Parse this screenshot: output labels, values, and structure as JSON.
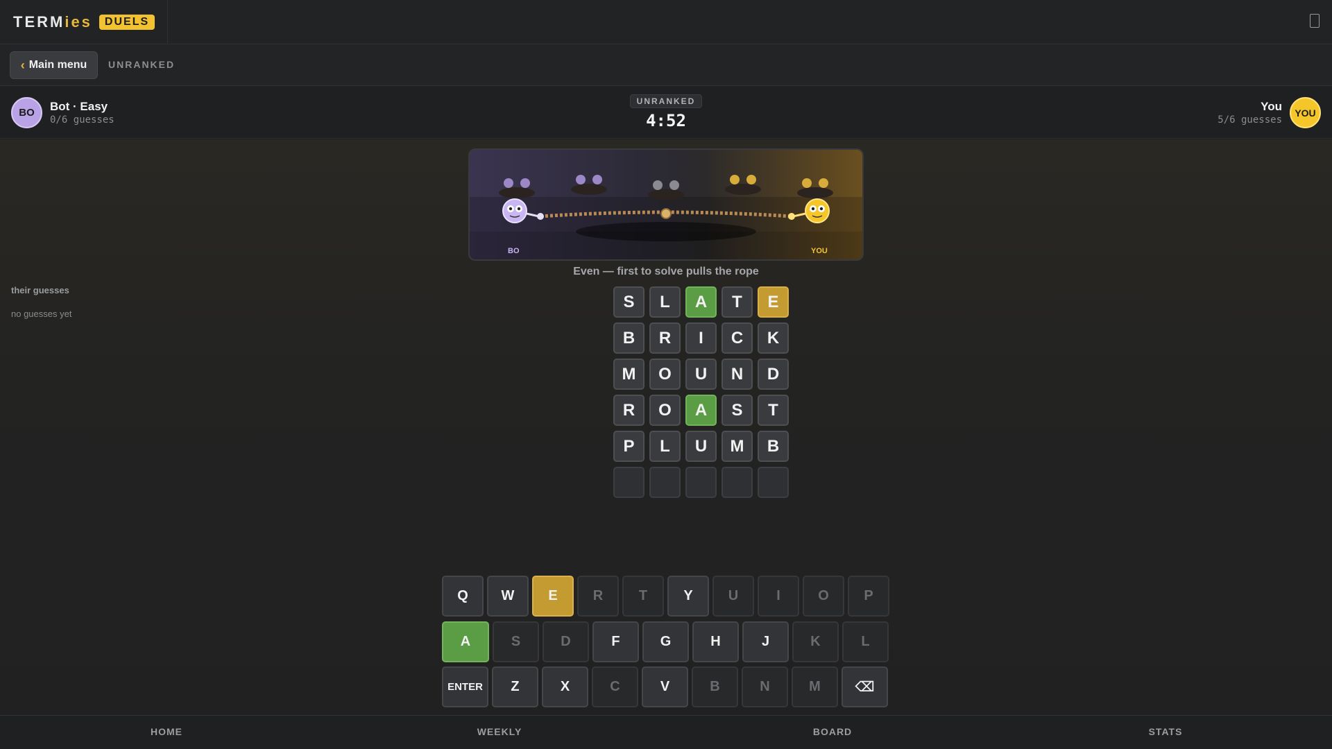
{
  "header": {
    "brand_main": "TERM",
    "brand_accent": "ies",
    "badge": "DUELS"
  },
  "subbar": {
    "back_label": "Main menu",
    "mode": "UNRANKED"
  },
  "match": {
    "opponent": {
      "initials": "BO",
      "name": "Bot · Easy",
      "guesses": "0/6 guesses"
    },
    "player": {
      "initials": "YOU",
      "name": "You",
      "guesses": "5/6 guesses"
    },
    "mode_badge": "UNRANKED",
    "timer": "4:52"
  },
  "side_panel": {
    "title": "their guesses",
    "empty_text": "no guesses yet"
  },
  "scene": {
    "left_label": "BO",
    "right_label": "YOU"
  },
  "status": "Even — first to solve pulls the rope",
  "board": {
    "rows": [
      [
        {
          "l": "S",
          "s": "absent"
        },
        {
          "l": "L",
          "s": "absent"
        },
        {
          "l": "A",
          "s": "correct"
        },
        {
          "l": "T",
          "s": "absent"
        },
        {
          "l": "E",
          "s": "present"
        }
      ],
      [
        {
          "l": "B",
          "s": "absent"
        },
        {
          "l": "R",
          "s": "absent"
        },
        {
          "l": "I",
          "s": "absent"
        },
        {
          "l": "C",
          "s": "absent"
        },
        {
          "l": "K",
          "s": "absent"
        }
      ],
      [
        {
          "l": "M",
          "s": "absent"
        },
        {
          "l": "O",
          "s": "absent"
        },
        {
          "l": "U",
          "s": "absent"
        },
        {
          "l": "N",
          "s": "absent"
        },
        {
          "l": "D",
          "s": "absent"
        }
      ],
      [
        {
          "l": "R",
          "s": "absent"
        },
        {
          "l": "O",
          "s": "absent"
        },
        {
          "l": "A",
          "s": "correct"
        },
        {
          "l": "S",
          "s": "absent"
        },
        {
          "l": "T",
          "s": "absent"
        }
      ],
      [
        {
          "l": "P",
          "s": "absent"
        },
        {
          "l": "L",
          "s": "absent"
        },
        {
          "l": "U",
          "s": "absent"
        },
        {
          "l": "M",
          "s": "absent"
        },
        {
          "l": "B",
          "s": "absent"
        }
      ],
      [
        {
          "l": "",
          "s": "empty"
        },
        {
          "l": "",
          "s": "empty"
        },
        {
          "l": "",
          "s": "empty"
        },
        {
          "l": "",
          "s": "empty"
        },
        {
          "l": "",
          "s": "empty"
        }
      ]
    ]
  },
  "keyboard": {
    "rows": [
      [
        {
          "k": "Q",
          "s": ""
        },
        {
          "k": "W",
          "s": ""
        },
        {
          "k": "E",
          "s": "present"
        },
        {
          "k": "R",
          "s": "used"
        },
        {
          "k": "T",
          "s": "used"
        },
        {
          "k": "Y",
          "s": ""
        },
        {
          "k": "U",
          "s": "used"
        },
        {
          "k": "I",
          "s": "used"
        },
        {
          "k": "O",
          "s": "used"
        },
        {
          "k": "P",
          "s": "used"
        }
      ],
      [
        {
          "k": "A",
          "s": "correct"
        },
        {
          "k": "S",
          "s": "used"
        },
        {
          "k": "D",
          "s": "used"
        },
        {
          "k": "F",
          "s": ""
        },
        {
          "k": "G",
          "s": ""
        },
        {
          "k": "H",
          "s": ""
        },
        {
          "k": "J",
          "s": ""
        },
        {
          "k": "K",
          "s": "used"
        },
        {
          "k": "L",
          "s": "used"
        }
      ],
      [
        {
          "k": "ENTER",
          "s": ""
        },
        {
          "k": "Z",
          "s": ""
        },
        {
          "k": "X",
          "s": ""
        },
        {
          "k": "C",
          "s": "used"
        },
        {
          "k": "V",
          "s": ""
        },
        {
          "k": "B",
          "s": "used"
        },
        {
          "k": "N",
          "s": "used"
        },
        {
          "k": "M",
          "s": "used"
        },
        {
          "k": "⌫",
          "s": ""
        }
      ]
    ]
  },
  "nav": [
    "HOME",
    "WEEKLY",
    "BOARD",
    "STATS"
  ],
  "colors": {
    "correct": "#5a9d44",
    "present": "#c49b30",
    "opponent": "#b9a2e6",
    "player": "#f5c629"
  }
}
